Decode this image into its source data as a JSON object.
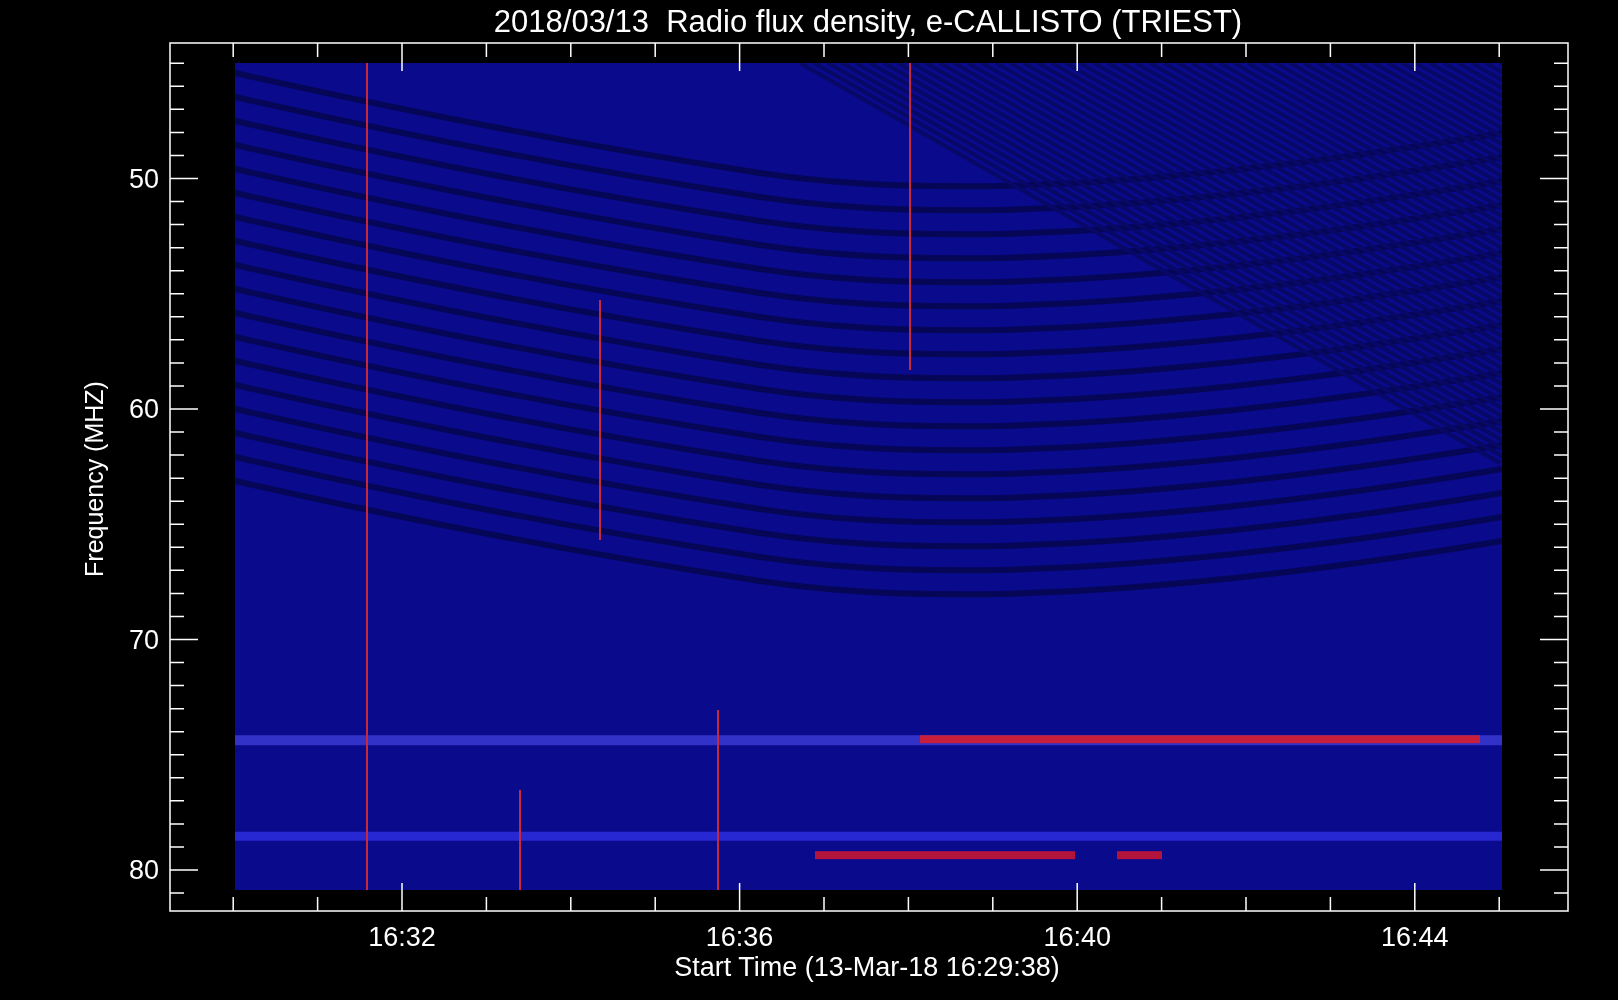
{
  "plot": {
    "title": "2018/03/13  Radio flux density, e-CALLISTO (TRIEST)",
    "ylabel": "Frequency (MHZ)",
    "xlabel": "Start Time (13-Mar-18 16:29:38)",
    "y_tick_labels": [
      "50",
      "60",
      "70",
      "80"
    ],
    "x_tick_labels": [
      "16:32",
      "16:36",
      "16:40",
      "16:44"
    ]
  }
}
